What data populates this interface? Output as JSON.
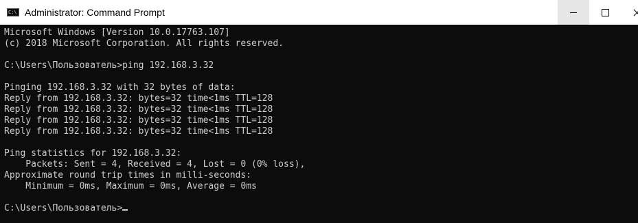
{
  "window": {
    "title": "Administrator: Command Prompt",
    "icon": "cmd-icon",
    "icon_text": "C:\\",
    "controls": [
      "minimize-icon",
      "maximize-icon",
      "close-icon"
    ]
  },
  "console": {
    "colors": {
      "background": "#0c0c0c",
      "text": "#cccccc"
    },
    "lines": [
      "Microsoft Windows [Version 10.0.17763.107]",
      "(c) 2018 Microsoft Corporation. All rights reserved.",
      "",
      "C:\\Users\\Пользователь>ping 192.168.3.32",
      "",
      "Pinging 192.168.3.32 with 32 bytes of data:",
      "Reply from 192.168.3.32: bytes=32 time<1ms TTL=128",
      "Reply from 192.168.3.32: bytes=32 time<1ms TTL=128",
      "Reply from 192.168.3.32: bytes=32 time<1ms TTL=128",
      "Reply from 192.168.3.32: bytes=32 time<1ms TTL=128",
      "",
      "Ping statistics for 192.168.3.32:",
      "    Packets: Sent = 4, Received = 4, Lost = 0 (0% loss),",
      "Approximate round trip times in milli-seconds:",
      "    Minimum = 0ms, Maximum = 0ms, Average = 0ms",
      ""
    ],
    "prompt": "C:\\Users\\Пользователь>"
  }
}
